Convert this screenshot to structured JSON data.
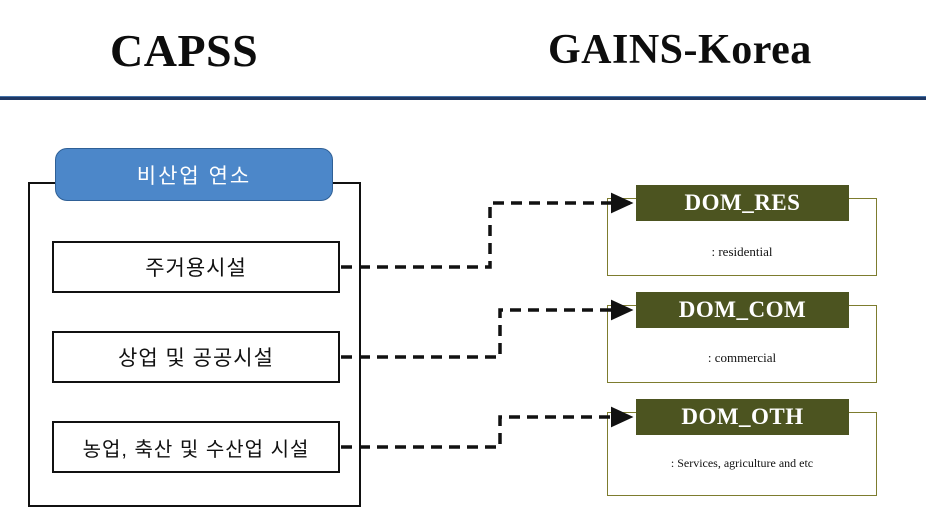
{
  "titles": {
    "left": "CAPSS",
    "right": "GAINS-Korea"
  },
  "capss": {
    "group_label": "비산업 연소",
    "items": [
      {
        "label": "주거용시설"
      },
      {
        "label": "상업 및 공공시설"
      },
      {
        "label": "농업, 축산 및 수산업 시설"
      }
    ]
  },
  "gains": {
    "items": [
      {
        "code": "DOM_RES",
        "description": ": residential"
      },
      {
        "code": "DOM_COM",
        "description": ": commercial"
      },
      {
        "code": "DOM_OTH",
        "description": ": Services, agriculture and etc"
      }
    ]
  },
  "colors": {
    "header_rule": "#1f3864",
    "capss_group_fill": "#4c87c9",
    "gains_header_fill": "#4c5420",
    "gains_border": "#7d7c2e",
    "box_border": "#111111"
  }
}
